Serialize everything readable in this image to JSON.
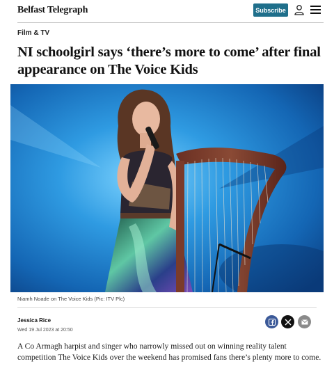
{
  "header": {
    "logo": "Belfast Telegraph",
    "subscribe_label": "Subscribe",
    "user_icon": "user-icon",
    "menu_icon": "hamburger-menu-icon"
  },
  "article": {
    "section": "Film & TV",
    "headline": "NI schoolgirl says ‘there’s more to come’ after final appearance on The Voice Kids",
    "image_caption": "Niamh Noade on The Voice Kids (Pic: ITV Plc)",
    "author": "Jessica Rice",
    "date": "Wed 19 Jul 2023 at 20:50",
    "standfirst": "A Co Armagh harpist and singer who narrowly missed out on winning reality talent competition The Voice Kids over the weekend has promised fans there’s plenty more to come."
  },
  "share": {
    "facebook_icon": "facebook-icon",
    "x_icon": "x-icon",
    "email_icon": "email-icon"
  },
  "colors": {
    "subscribe_bg": "#1f6f8b",
    "facebook": "#3b5998",
    "x": "#111111",
    "email": "#8a8a8a",
    "stage_blue": "#1e8fd6"
  }
}
